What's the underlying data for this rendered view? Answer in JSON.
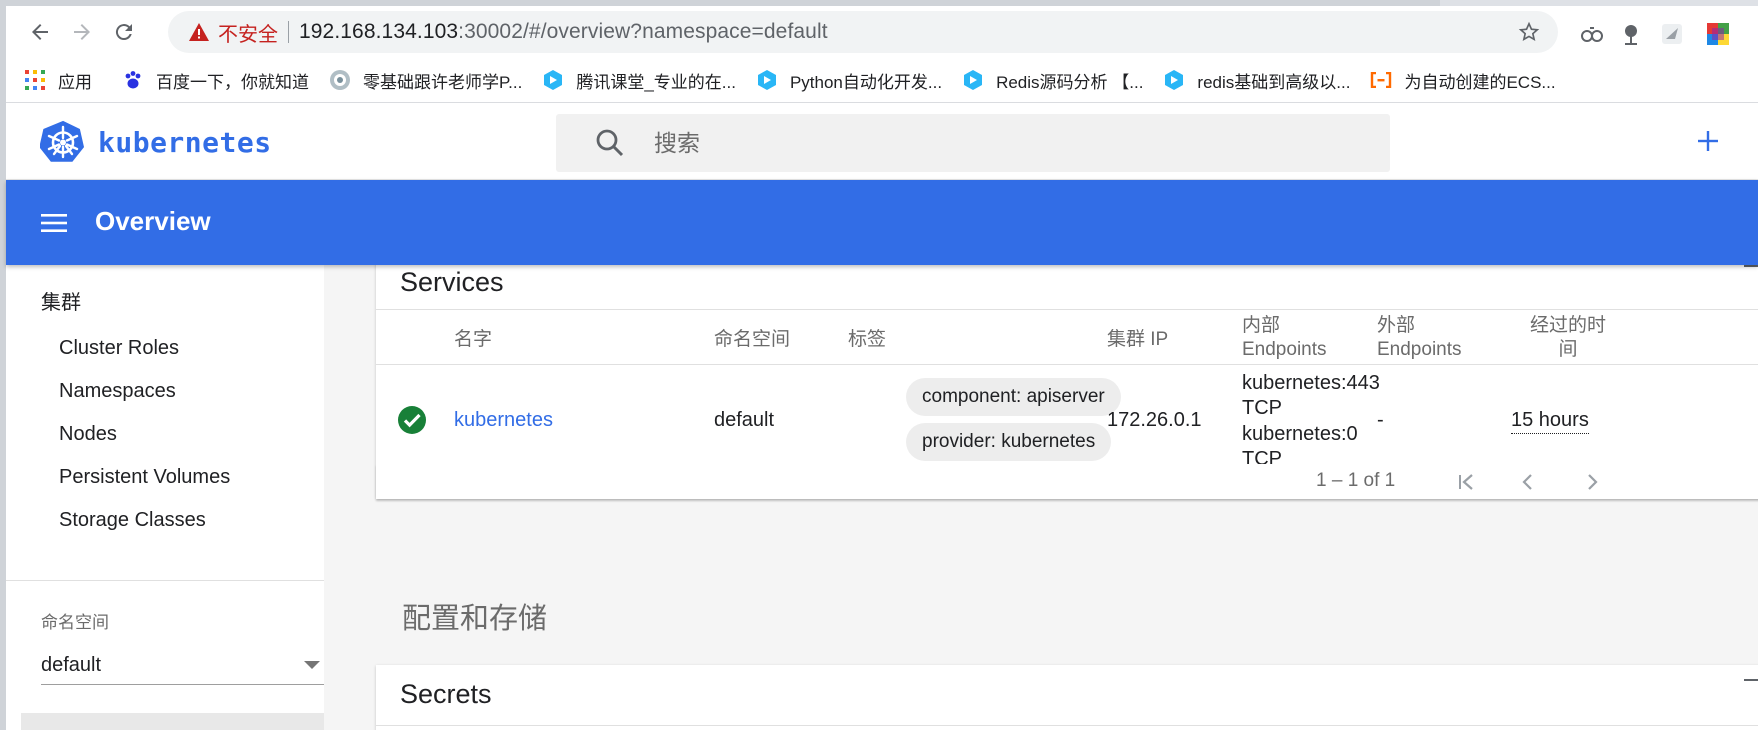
{
  "browser": {
    "insecure_label": "不安全",
    "url_host": "192.168.134.103",
    "url_rest": ":30002/#/overview?namespace=default"
  },
  "bookmarks": [
    {
      "label": "应用",
      "icon": "apps-grid-icon"
    },
    {
      "label": "百度一下，你就知道",
      "icon": "baidu-paw-icon"
    },
    {
      "label": "零基础跟许老师学P...",
      "icon": "site-globe-icon"
    },
    {
      "label": "腾讯课堂_专业的在...",
      "icon": "tencent-classroom-icon"
    },
    {
      "label": "Python自动化开发...",
      "icon": "tencent-classroom-icon"
    },
    {
      "label": "Redis源码分析 【...",
      "icon": "tencent-classroom-icon"
    },
    {
      "label": "redis基础到高级以...",
      "icon": "tencent-classroom-icon"
    },
    {
      "label": "为自动创建的ECS...",
      "icon": "aliyun-icon"
    }
  ],
  "app": {
    "brand": "kubernetes",
    "search_placeholder": "搜索",
    "page_title": "Overview"
  },
  "sidebar": {
    "cluster_heading": "集群",
    "items": [
      "Cluster Roles",
      "Namespaces",
      "Nodes",
      "Persistent Volumes",
      "Storage Classes"
    ],
    "namespace_label": "命名空间",
    "namespace_value": "default"
  },
  "services": {
    "title": "Services",
    "columns": {
      "name": "名字",
      "namespace": "命名空间",
      "labels": "标签",
      "cluster_ip": "集群 IP",
      "internal_1": "内部",
      "internal_2": "Endpoints",
      "external_1": "外部",
      "external_2": "Endpoints",
      "age_1": "经过的时",
      "age_2": "间"
    },
    "rows": [
      {
        "status": "ok",
        "name": "kubernetes",
        "namespace": "default",
        "labels": [
          "component: apiserver",
          "provider: kubernetes"
        ],
        "cluster_ip": "172.26.0.1",
        "internal": [
          "kubernetes:443",
          "TCP",
          "kubernetes:0",
          "TCP"
        ],
        "external": "-",
        "age": "15 hours"
      }
    ],
    "pagination": "1 – 1 of 1"
  },
  "config_storage_heading": "配置和存储",
  "secrets": {
    "title": "Secrets"
  },
  "colors": {
    "accent": "#326de6",
    "ok_green": "#188038",
    "insecure_red": "#c5221f"
  }
}
